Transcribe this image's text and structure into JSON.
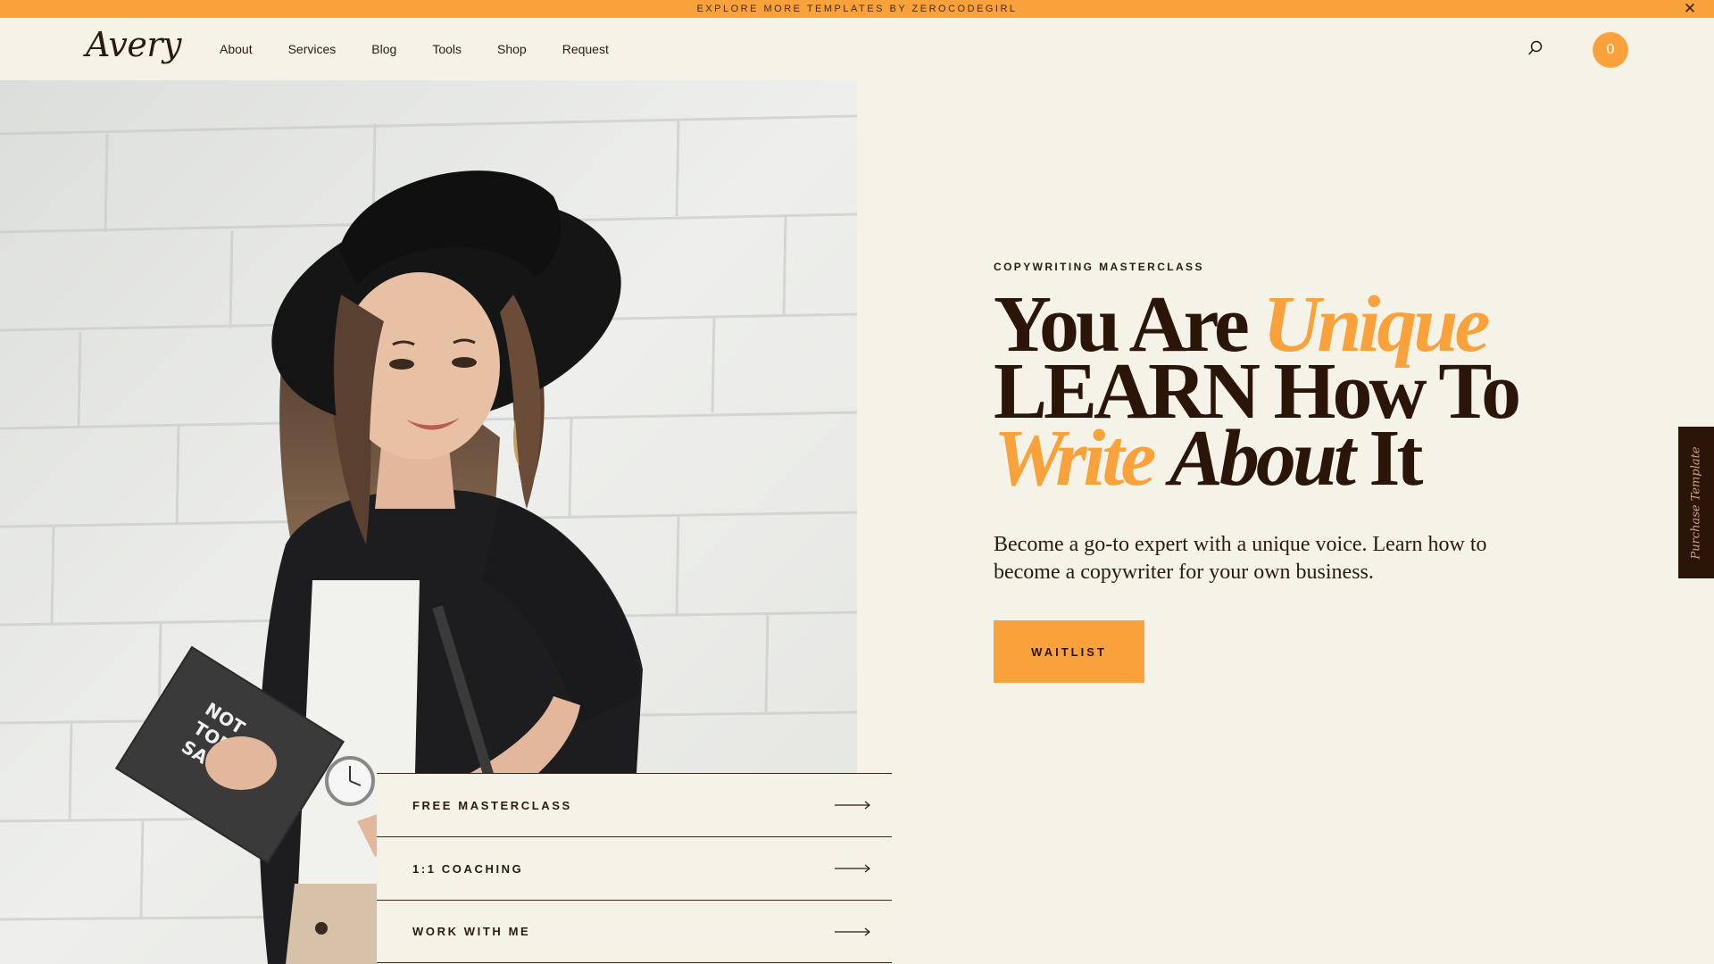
{
  "announcement": {
    "text": "EXPLORE MORE TEMPLATES BY ZEROCODEGIRL",
    "close_label": "✕"
  },
  "header": {
    "logo": "Avery",
    "nav": [
      "About",
      "Services",
      "Blog",
      "Tools",
      "Shop",
      "Request"
    ],
    "cart_count": "0"
  },
  "hero": {
    "eyebrow": "COPYWRITING MASTERCLASS",
    "headline": {
      "line1_plain": "You Are",
      "line1_accent": "Unique",
      "line2": "LEARN How To",
      "line3_accent": "Write",
      "line3_italic": "About",
      "line3_plain": "It"
    },
    "lede": "Become a go-to expert with a unique voice. Learn how to become a copywriter for your own business.",
    "cta": "WAITLIST",
    "notebook_text": [
      "NOT",
      "TODAY,",
      "SATAN!"
    ]
  },
  "side_tab": "Purchase Template",
  "menu": [
    "FREE MASTERCLASS",
    "1:1 COACHING",
    "WORK WITH ME"
  ],
  "colors": {
    "accent": "#f9a23b",
    "dark": "#2a1508",
    "background": "#f5f2e8"
  }
}
